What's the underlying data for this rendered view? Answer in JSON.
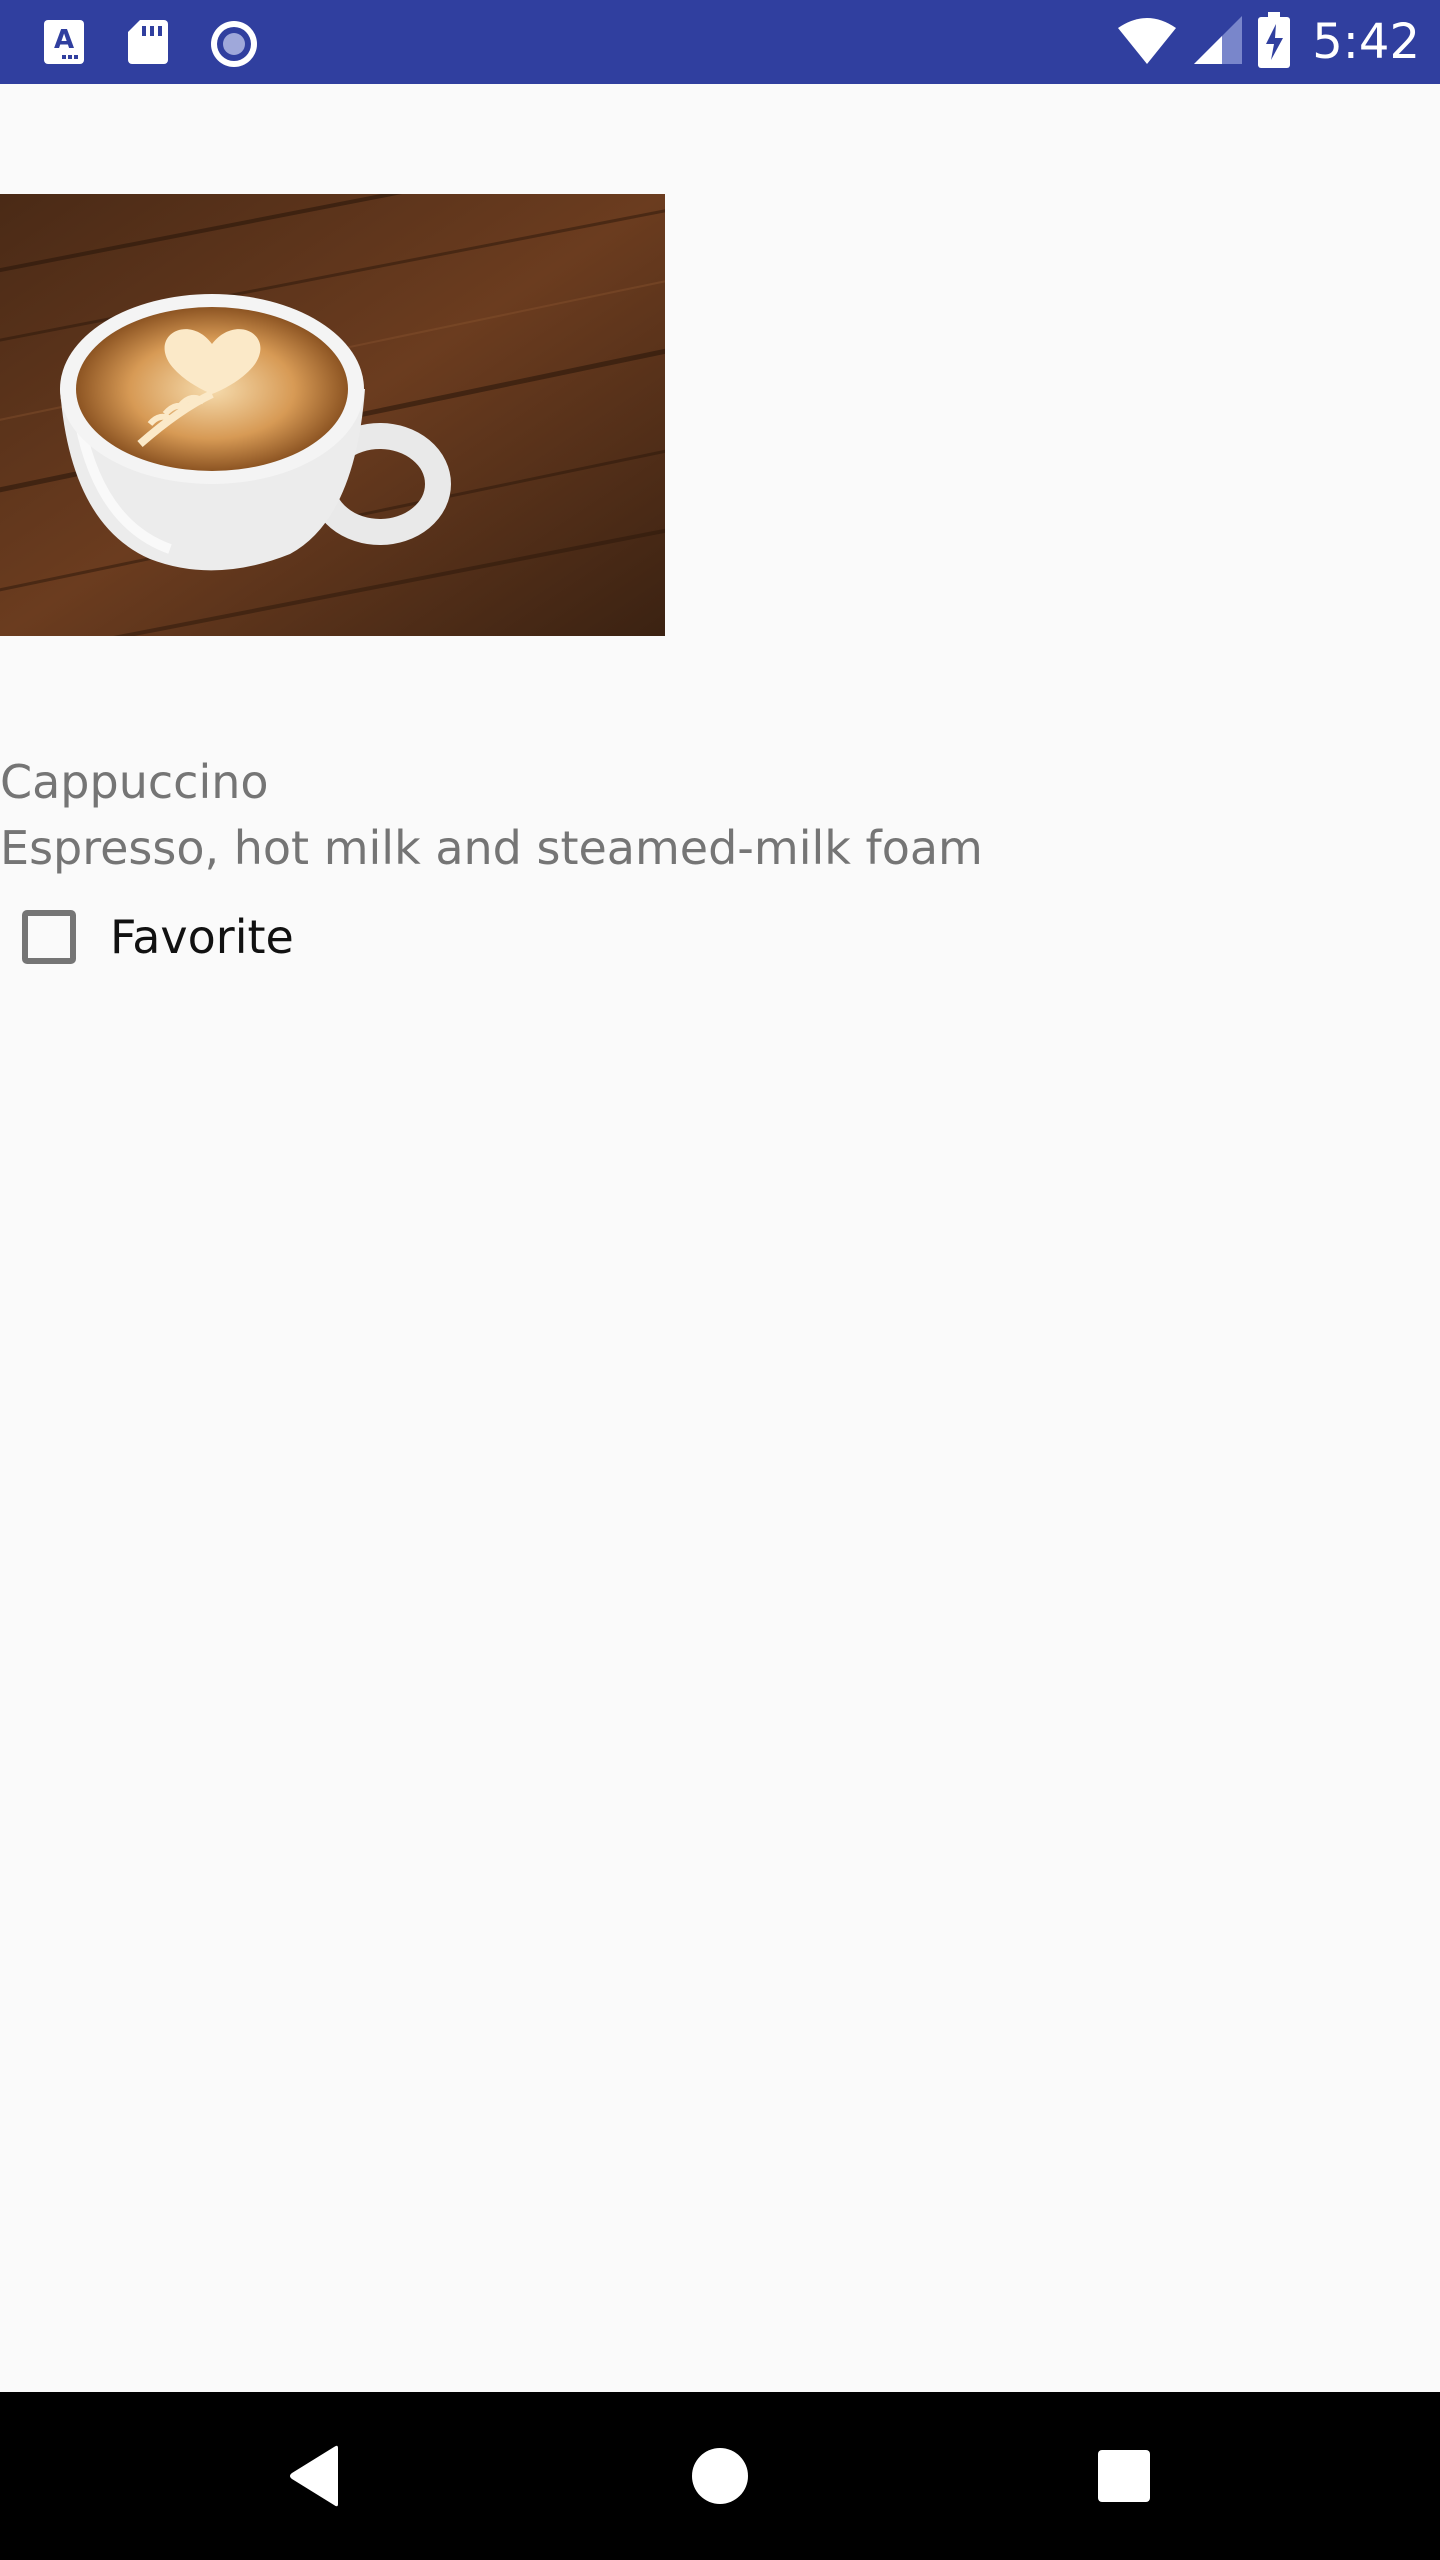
{
  "status_bar": {
    "time": "5:42",
    "left_icons": [
      "font-notification-icon",
      "sd-card-icon",
      "record-icon"
    ],
    "right_icons": [
      "wifi-icon",
      "cell-signal-icon",
      "battery-charging-icon"
    ],
    "background_color": "#303f9f"
  },
  "coffee": {
    "image_icon": "cappuccino-photo",
    "name": "Cappuccino",
    "description": "Espresso, hot milk and steamed-milk foam"
  },
  "favorite": {
    "label": "Favorite",
    "checked": false
  },
  "nav_bar": {
    "buttons": [
      "back-icon",
      "home-icon",
      "recents-icon"
    ]
  }
}
